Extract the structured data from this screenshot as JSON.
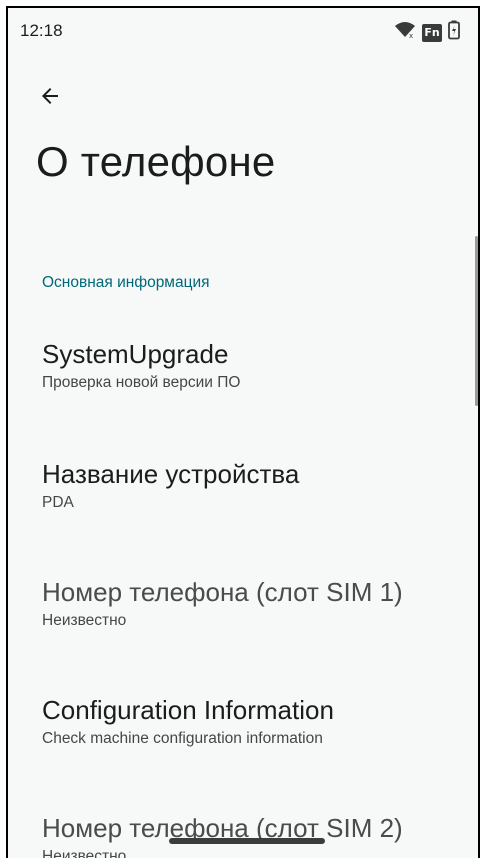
{
  "status_bar": {
    "time": "12:18",
    "icons": [
      "wifi-icon",
      "fn-badge",
      "battery-icon"
    ],
    "fn_label": "Fn"
  },
  "header": {
    "back_icon": "arrow-back-icon",
    "title": "О телефоне"
  },
  "section": {
    "title": "Основная информация"
  },
  "items": [
    {
      "title": "SystemUpgrade",
      "summary": "Проверка новой версии ПО",
      "enabled": true
    },
    {
      "title": "Название устройства",
      "summary": "PDA",
      "enabled": true
    },
    {
      "title": "Номер телефона (слот SIM 1)",
      "summary": "Неизвестно",
      "enabled": false
    },
    {
      "title": "Configuration Information",
      "summary": "Check machine configuration information",
      "enabled": true
    },
    {
      "title": "Номер телефона (слот SIM 2)",
      "summary": "Неизвестно",
      "enabled": false
    }
  ],
  "colors": {
    "accent": "#006876",
    "background": "#f7f9f9",
    "title_text": "#1b1c1c"
  }
}
